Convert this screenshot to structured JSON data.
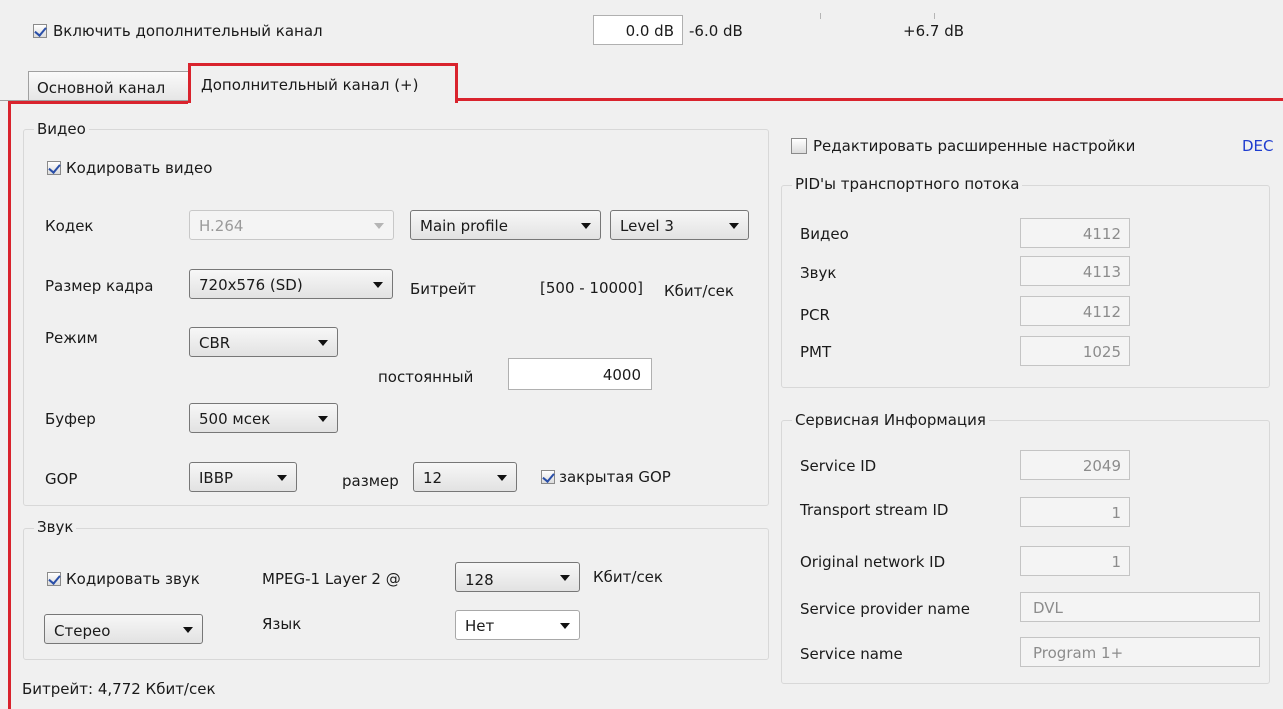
{
  "top_bar": {
    "enable_extra_channel_label": "Включить дополнительный канал",
    "enable_extra_channel_checked": true,
    "level_value": "0.0 dB",
    "level_min": "-6.0 dB",
    "level_max": "+6.7 dB"
  },
  "tabs": [
    {
      "label": "Основной канал",
      "active": false
    },
    {
      "label": "Дополнительный канал (+)",
      "active": true
    }
  ],
  "highlight_color": "#d9232d",
  "video": {
    "group_label": "Видео",
    "encode_label": "Кодировать видео",
    "encode_checked": true,
    "codec_label": "Кодек",
    "codec_value": "H.264",
    "profile_value": "Main profile",
    "level_value": "Level 3",
    "frame_size_label": "Размер кадра",
    "frame_size_value": "720x576 (SD)",
    "bitrate_label": "Битрейт",
    "bitrate_range": "[500 - 10000]",
    "bitrate_unit": "Кбит/сек",
    "mode_label": "Режим",
    "mode_value": "CBR",
    "constant_label": "постоянный",
    "constant_value": "4000",
    "buffer_label": "Буфер",
    "buffer_value": "500 мсек",
    "gop_label": "GOP",
    "gop_value": "IBBP",
    "gop_size_label": "размер",
    "gop_size_value": "12",
    "closed_gop_label": "закрытая GOP",
    "closed_gop_checked": true
  },
  "audio": {
    "group_label": "Звук",
    "encode_label": "Кодировать звук",
    "encode_checked": true,
    "format_label": "MPEG-1 Layer 2 @",
    "bitrate_value": "128",
    "bitrate_unit": "Кбит/сек",
    "channels_value": "Стерео",
    "language_label": "Язык",
    "language_value": "Нет"
  },
  "footer": {
    "total_bitrate": "Битрейт: 4,772 Кбит/сек"
  },
  "advanced": {
    "edit_label": "Редактировать расширенные настройки",
    "edit_checked": false,
    "mode_link": "DEC"
  },
  "pids": {
    "group_label": "PID'ы транспортного потока",
    "rows": [
      {
        "label": "Видео",
        "value": "4112"
      },
      {
        "label": "Звук",
        "value": "4113"
      },
      {
        "label": "PCR",
        "value": "4112"
      },
      {
        "label": "PMT",
        "value": "1025"
      }
    ]
  },
  "service_info": {
    "group_label": "Сервисная Информация",
    "service_id_label": "Service ID",
    "service_id_value": "2049",
    "ts_id_label": "Transport stream ID",
    "ts_id_value": "1",
    "onid_label": "Original network ID",
    "onid_value": "1",
    "provider_label": "Service provider name",
    "provider_value": "DVL",
    "name_label": "Service name",
    "name_value": "Program 1+"
  }
}
